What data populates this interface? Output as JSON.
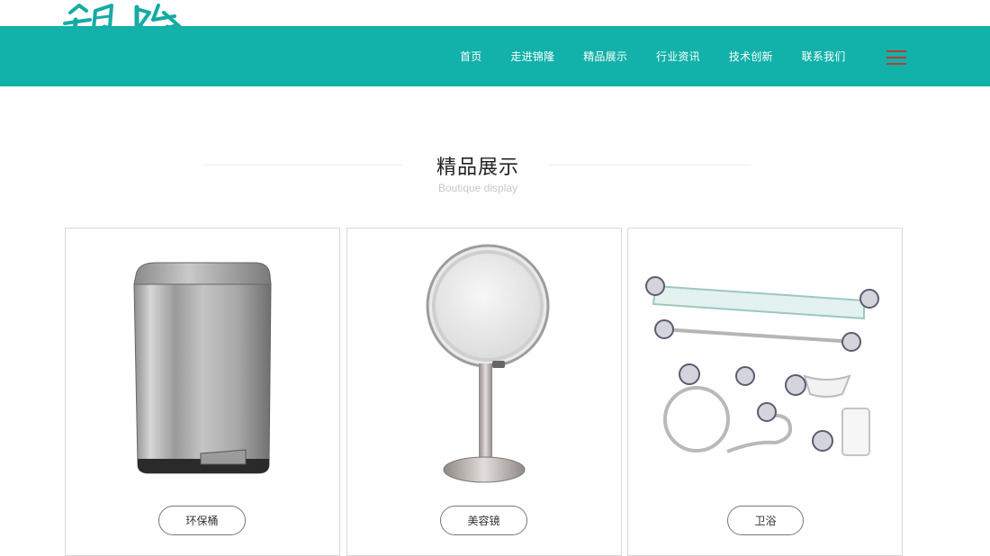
{
  "header": {
    "logo_text": "錦隆",
    "brand_color": "#12b1aa",
    "menu_icon_color": "#c0392b"
  },
  "nav": {
    "items": [
      {
        "label": "首页"
      },
      {
        "label": "走进锦隆"
      },
      {
        "label": "精品展示"
      },
      {
        "label": "行业资讯"
      },
      {
        "label": "技术创新"
      },
      {
        "label": "联系我们"
      }
    ],
    "menu_icon": "hamburger-icon"
  },
  "section": {
    "title": "精品展示",
    "subtitle": "Boutique display"
  },
  "products": [
    {
      "name": "环保桶",
      "image": "trash-can-image"
    },
    {
      "name": "美容镜",
      "image": "vanity-mirror-image"
    },
    {
      "name": "卫浴",
      "image": "bathroom-accessories-image"
    }
  ]
}
